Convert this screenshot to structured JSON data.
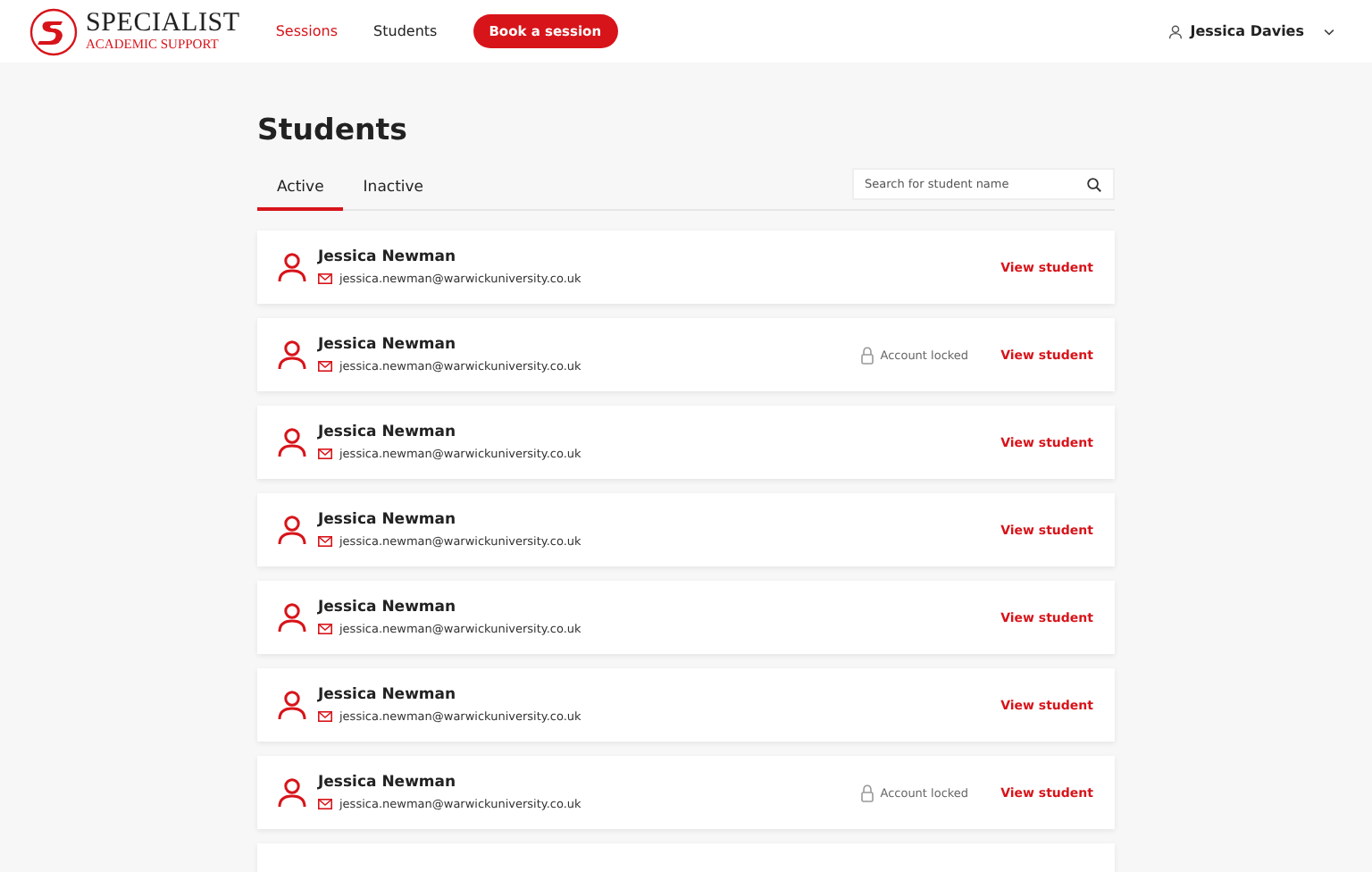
{
  "header": {
    "logo": {
      "title": "SPECIALIST",
      "subtitle": "ACADEMIC SUPPORT"
    },
    "nav": [
      {
        "label": "Sessions",
        "selected": true
      },
      {
        "label": "Students",
        "selected": false
      }
    ],
    "cta": "Book a session",
    "user": "Jessica Davies"
  },
  "page": {
    "title": "Students",
    "tabs": [
      {
        "label": "Active",
        "selected": true
      },
      {
        "label": "Inactive",
        "selected": false
      }
    ],
    "search": {
      "placeholder": "Search for student name"
    },
    "students": [
      {
        "name": "Jessica Newman",
        "email": "jessica.newman@warwickuniversity.co.uk",
        "locked": false,
        "action": "View student"
      },
      {
        "name": "Jessica Newman",
        "email": "jessica.newman@warwickuniversity.co.uk",
        "locked": true,
        "status": "Account locked",
        "action": "View student"
      },
      {
        "name": "Jessica Newman",
        "email": "jessica.newman@warwickuniversity.co.uk",
        "locked": false,
        "action": "View student"
      },
      {
        "name": "Jessica Newman",
        "email": "jessica.newman@warwickuniversity.co.uk",
        "locked": false,
        "action": "View student"
      },
      {
        "name": "Jessica Newman",
        "email": "jessica.newman@warwickuniversity.co.uk",
        "locked": false,
        "action": "View student"
      },
      {
        "name": "Jessica Newman",
        "email": "jessica.newman@warwickuniversity.co.uk",
        "locked": false,
        "action": "View student"
      },
      {
        "name": "Jessica Newman",
        "email": "jessica.newman@warwickuniversity.co.uk",
        "locked": true,
        "status": "Account locked",
        "action": "View student"
      }
    ]
  }
}
